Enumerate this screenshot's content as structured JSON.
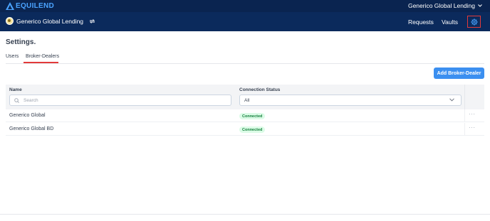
{
  "brand": {
    "name": "EQUILEND",
    "logo_icon": "triangle-logo-icon",
    "accent": "#4aa3ff"
  },
  "topbar": {
    "org_label": "Generico Global Lending",
    "chevron_icon": "chevron-down-icon"
  },
  "navbar": {
    "entity_label": "Generico Global Lending",
    "swap_icon": "swap-arrows-icon",
    "links": [
      "Requests",
      "Vaults"
    ],
    "settings_icon": "gear-icon"
  },
  "page": {
    "title": "Settings."
  },
  "tabs": {
    "items": [
      "Users",
      "Broker-Dealers"
    ],
    "active": "Broker-Dealers",
    "active_color": "#e23a3a"
  },
  "actions": {
    "add_label": "Add Broker-Dealer",
    "add_color": "#3b8ff0"
  },
  "table": {
    "columns": {
      "name": "Name",
      "status": "Connection Status"
    },
    "filters": {
      "search_placeholder": "Search",
      "search_value": "",
      "status_selected": "All"
    },
    "rows": [
      {
        "name": "Generico Global",
        "status": "Connected",
        "more": "···"
      },
      {
        "name": "Generico Global BD",
        "status": "Connected",
        "more": "···"
      }
    ],
    "status_color": "#15803d"
  }
}
